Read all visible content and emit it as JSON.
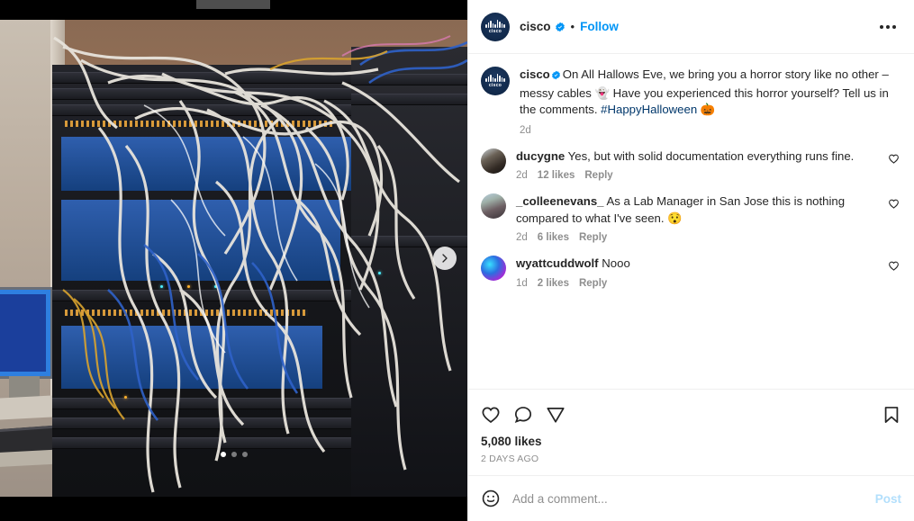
{
  "header": {
    "username": "cisco",
    "verified_icon": "verified-badge-icon",
    "separator": "•",
    "follow_label": "Follow",
    "more_icon": "more-options-icon",
    "avatar_label": "cisco"
  },
  "media": {
    "alt": "Server rack overflowing with tangled white and blue network cables",
    "next_icon": "chevron-right-icon",
    "carousel": {
      "total": 3,
      "active": 1
    }
  },
  "caption": {
    "username": "cisco",
    "verified_icon": "verified-badge-icon",
    "text_part1": "On All Hallows Eve, we bring you a horror story like no other – messy cables ",
    "emoji1": "👻",
    "text_part2": " Have you experienced this horror yourself? Tell us in the comments. ",
    "hashtag": "#HappyHalloween",
    "emoji2": "🎃",
    "time": "2d"
  },
  "comments": [
    {
      "username": "ducygne",
      "text": "Yes, but with solid documentation everything runs fine.",
      "emoji": "",
      "time": "2d",
      "likes": "12 likes",
      "reply": "Reply",
      "like_icon": "heart-outline-icon"
    },
    {
      "username": "_colleenevans_",
      "text": "As a Lab Manager in San Jose this is nothing compared to what I've seen. ",
      "emoji": "😯",
      "time": "2d",
      "likes": "6 likes",
      "reply": "Reply",
      "like_icon": "heart-outline-icon"
    },
    {
      "username": "wyattcuddwolf",
      "text": "Nooo",
      "emoji": "",
      "time": "1d",
      "likes": "2 likes",
      "reply": "Reply",
      "like_icon": "heart-outline-icon"
    }
  ],
  "actions": {
    "like_icon": "heart-outline-icon",
    "comment_icon": "comment-bubble-icon",
    "share_icon": "share-paper-plane-icon",
    "save_icon": "bookmark-outline-icon",
    "likes_count": "5,080 likes",
    "posted_ago": "2 DAYS AGO"
  },
  "add_comment": {
    "emoji_icon": "emoji-smiley-icon",
    "placeholder": "Add a comment...",
    "value": "",
    "post_label": "Post"
  },
  "colors": {
    "accent_blue": "#0095f6",
    "post_disabled": "#b2dffc",
    "text_primary": "#262626",
    "text_secondary": "#8e8e8e",
    "hashtag": "#00376b",
    "border": "#efefef"
  }
}
